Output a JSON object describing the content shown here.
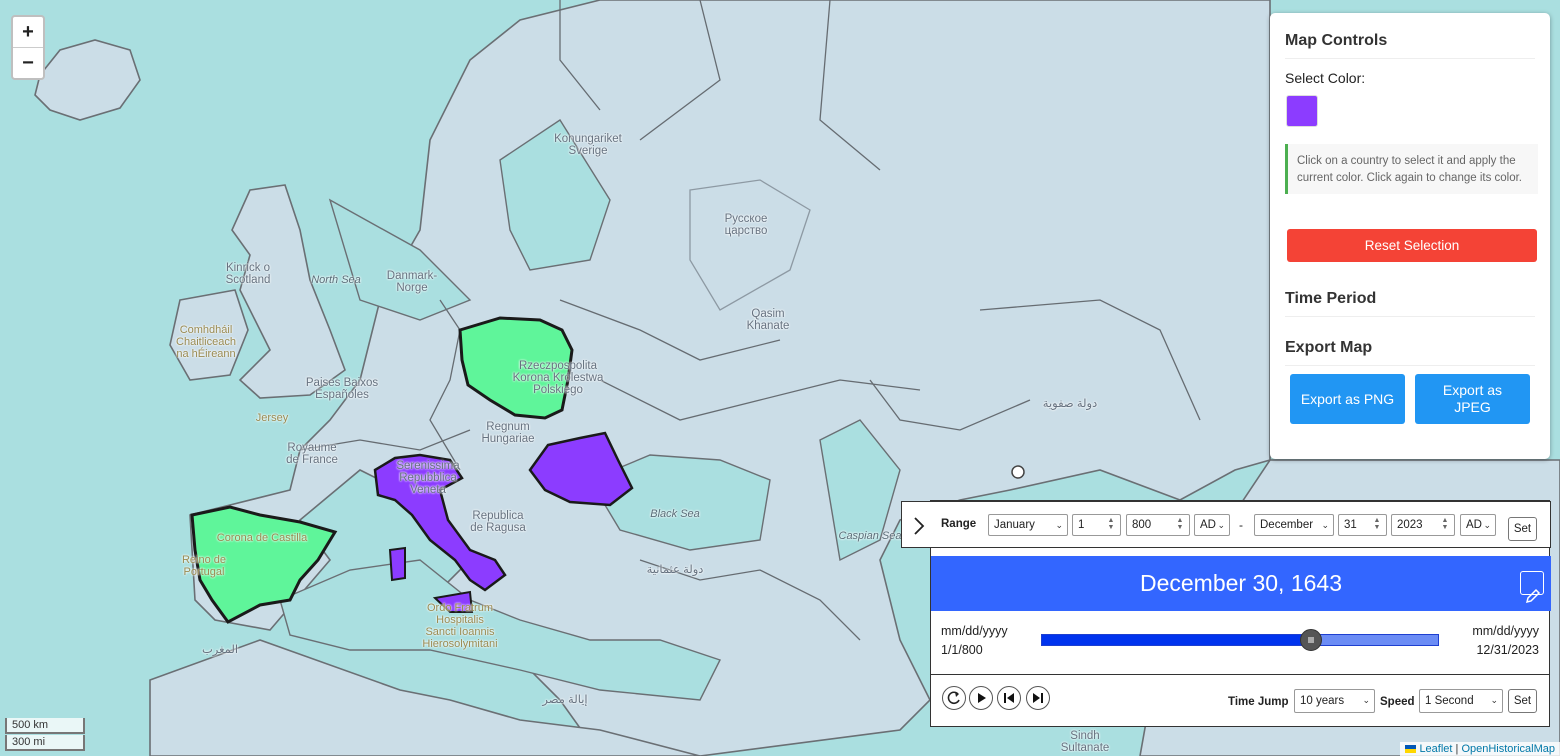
{
  "map": {
    "zoom_in": "+",
    "zoom_out": "−",
    "scale_km": "500 km",
    "scale_mi": "300 mi",
    "labels": {
      "sweden": "Konungariket\nSverige",
      "russia": "Русское\nцарство",
      "qasim": "Qasim\nKhanate",
      "scotland": "Kinrick o\nScotland",
      "denmark": "Danmark-\nNorge",
      "north_sea": "North Sea",
      "ireland": "Comhdháil\nChaitliceach\nna hÉireann",
      "netherlands": "Paises Baixos\nEspañoles",
      "jersey": "Jersey",
      "france": "Royaume\nde France",
      "poland": "Rzeczpospolita\nKorona Królestwa\nPolskiego",
      "hungary": "Regnum\nHungariae",
      "venice": "Serenissima\nRepubblica\nVeneta",
      "ragusa": "Republica\nde Ragusa",
      "portugal": "Reino de\nPortugal",
      "castile": "Corona de Castilla",
      "black_sea": "Black Sea",
      "caspian": "Caspian Sea",
      "hospitallers": "Ordo Fratrum\nHospitalis\nSancti Ioannis\nHierosolymitani",
      "sindh": "Sindh\nSultanate",
      "arabic_1": "دولة صفوية",
      "arabic_2": "دولة عثمانية",
      "arabic_3": "إيالة مصر",
      "arabic_4": "المغرب"
    },
    "colors": {
      "selected_green": "#5ff59a",
      "selected_purple": "#8c3cff",
      "sea": "#aadfe0",
      "land": "#c9dde6"
    },
    "attribution": {
      "leaflet": "Leaflet",
      "sep": "|",
      "source": "OpenHistoricalMap"
    }
  },
  "controls": {
    "title": "Map Controls",
    "select_color_label": "Select Color:",
    "selected_color": "#8c3cff",
    "info_text": "Click on a country to select it and apply the current color. Click again to change its color.",
    "reset_button": "Reset Selection",
    "time_period_title": "Time Period",
    "export_title": "Export Map",
    "export_png": "Export as PNG",
    "export_jpeg": "Export as JPEG"
  },
  "timeline": {
    "range_label": "Range",
    "start_month": "January",
    "start_day": "1",
    "start_year": "800",
    "start_era": "AD",
    "dash": "-",
    "end_month": "December",
    "end_day": "31",
    "end_year": "2023",
    "end_era": "AD",
    "set_label": "Set",
    "current_date": "December 30, 1643",
    "start_format": "mm/dd/yyyy",
    "start_value": "1/1/800",
    "end_format": "mm/dd/yyyy",
    "end_value": "12/31/2023",
    "progress_fraction": 0.6775,
    "time_jump_label": "Time Jump",
    "time_jump_value": "10 years",
    "speed_label": "Speed",
    "speed_value": "1 Second",
    "set_label_2": "Set"
  }
}
